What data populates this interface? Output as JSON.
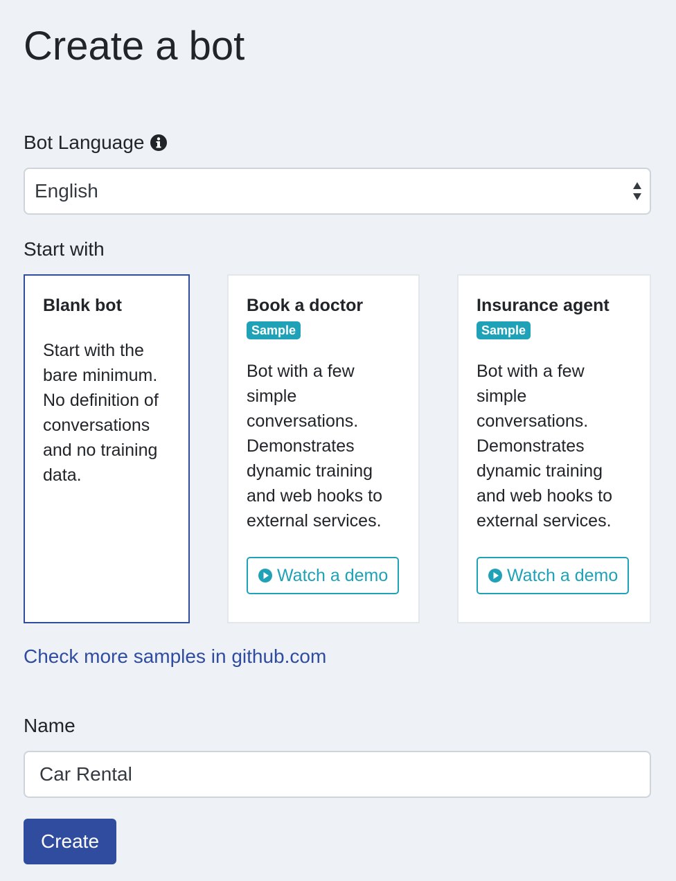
{
  "page": {
    "title": "Create a bot"
  },
  "language": {
    "label": "Bot Language",
    "info_icon": "info-circle-icon",
    "selected": "English",
    "arrow_icon": "select-arrows-icon"
  },
  "start_with": {
    "label": "Start with",
    "cards": [
      {
        "title": "Blank bot",
        "badge": "",
        "description": "Start with the bare minimum. No definition of conversations and no training data.",
        "selected": true
      },
      {
        "title": "Book a doctor",
        "badge": "Sample",
        "description": "Bot with a few simple conversations. Demonstrates dynamic training and web hooks to external services.",
        "demo_label": "Watch a demo",
        "demo_icon": "play-circle-icon",
        "selected": false
      },
      {
        "title": "Insurance agent",
        "badge": "Sample",
        "description": "Bot with a few simple conversations. Demonstrates dynamic training and web hooks to external services.",
        "demo_label": "Watch a demo",
        "demo_icon": "play-circle-icon",
        "selected": false
      }
    ]
  },
  "samples_link": {
    "text": "Check more samples in github.com"
  },
  "name": {
    "label": "Name",
    "value": "Car Rental"
  },
  "create_button": {
    "label": "Create"
  },
  "colors": {
    "primary": "#2f4c9f",
    "info": "#1fa2b8",
    "background": "#eef1f6"
  }
}
